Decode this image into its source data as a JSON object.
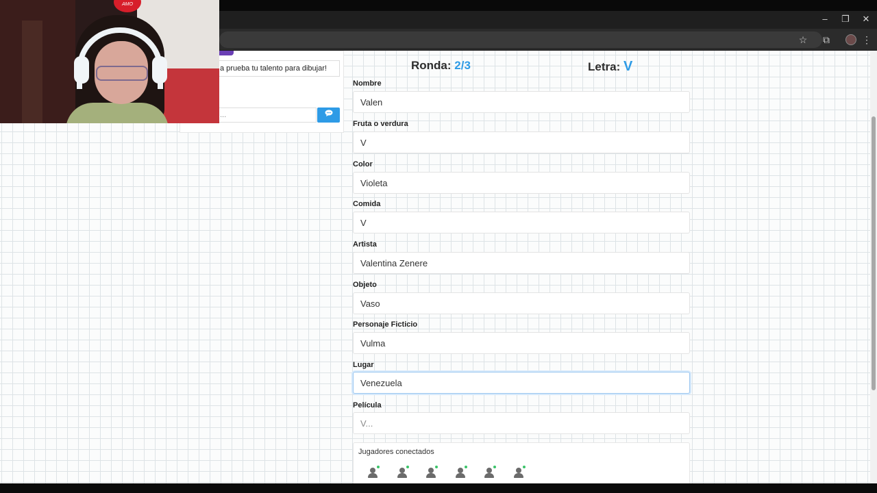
{
  "browser": {
    "window_controls": {
      "minimize": "–",
      "restore": "❐",
      "close": "✕"
    },
    "toolbar_icons": {
      "bookmark": "☆",
      "extensions": "⧉",
      "menu": "⋮"
    }
  },
  "left_panel": {
    "tagline": "a prueba tu talento para dibujar!",
    "chat_input_placeholder": "...",
    "send_icon": "speech-bubble-icon",
    "send_glyph": "💬"
  },
  "header": {
    "ronda_label": "Ronda:",
    "ronda_value": "2/3",
    "letra_label": "Letra:",
    "letra_value": "V"
  },
  "form": {
    "fields": [
      {
        "label": "Nombre",
        "value": "Valen",
        "placeholder": ""
      },
      {
        "label": "Fruta o verdura",
        "value": "V",
        "placeholder": ""
      },
      {
        "label": "Color",
        "value": "Violeta",
        "placeholder": ""
      },
      {
        "label": "Comida",
        "value": "V",
        "placeholder": ""
      },
      {
        "label": "Artista",
        "value": "Valentina Zenere",
        "placeholder": ""
      },
      {
        "label": "Objeto",
        "value": "Vaso",
        "placeholder": ""
      },
      {
        "label": "Personaje Ficticio",
        "value": "Vulma",
        "placeholder": ""
      },
      {
        "label": "Lugar",
        "value": "Venezuela",
        "placeholder": ""
      },
      {
        "label": "Película",
        "value": "",
        "placeholder": "V..."
      }
    ]
  },
  "players": {
    "title": "Jugadores conectados",
    "count_shown": 6,
    "online_color": "#3cc46a"
  },
  "webcam": {
    "balloon_text": "AMO"
  },
  "colors": {
    "accent": "#2e9be6",
    "grid": "#dde3e6",
    "purple": "#6a3fb5"
  }
}
